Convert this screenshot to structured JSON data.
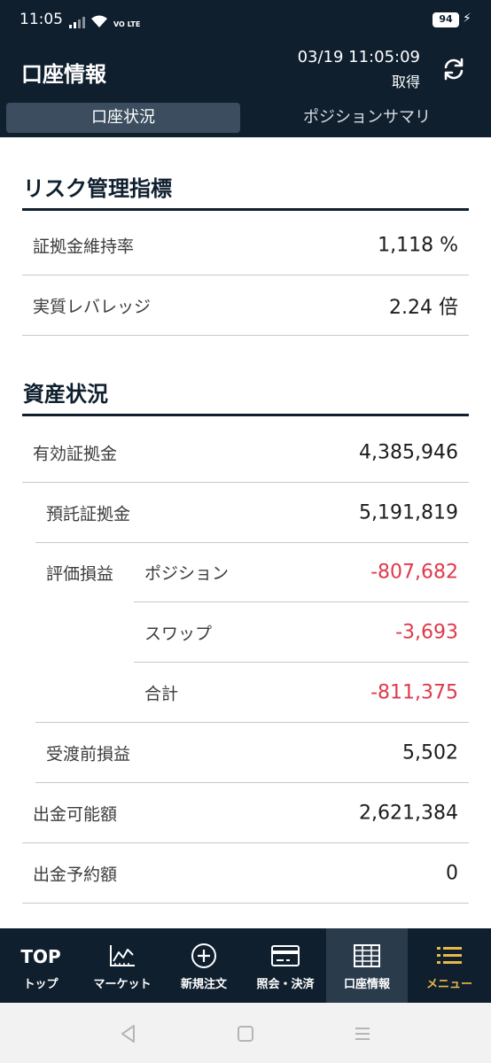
{
  "status_bar": {
    "time": "11:05",
    "network": "VO LTE",
    "battery": "94"
  },
  "header": {
    "title": "口座情報",
    "timestamp": "03/19 11:05:09",
    "fetch_label": "取得",
    "refresh_icon": "refresh-icon"
  },
  "tabs": [
    {
      "label": "口座状況",
      "active": true
    },
    {
      "label": "ポジションサマリ",
      "active": false
    }
  ],
  "risk": {
    "title": "リスク管理指標",
    "rows": [
      {
        "label": "証拠金維持率",
        "value": "1,118 %"
      },
      {
        "label": "実質レバレッジ",
        "value": "2.24 倍"
      }
    ]
  },
  "assets": {
    "title": "資産状況",
    "effective_margin": {
      "label": "有効証拠金",
      "value": "4,385,946"
    },
    "deposit_margin": {
      "label": "預託証拠金",
      "value": "5,191,819"
    },
    "valuation": {
      "label": "評価損益",
      "position": {
        "label": "ポジション",
        "value": "-807,682"
      },
      "swap": {
        "label": "スワップ",
        "value": "-3,693"
      },
      "total": {
        "label": "合計",
        "value": "-811,375"
      }
    },
    "pre_settlement": {
      "label": "受渡前損益",
      "value": "5,502"
    },
    "withdrawable": {
      "label": "出金可能額",
      "value": "2,621,384"
    },
    "withdraw_reserved": {
      "label": "出金予約額",
      "value": "0"
    }
  },
  "colors": {
    "navy": "#0f1f2e",
    "negative": "#e0394a",
    "menu_accent": "#e8b84a"
  },
  "bottom_nav": {
    "top": {
      "icon_text": "TOP",
      "label": "トップ"
    },
    "market": {
      "label": "マーケット",
      "icon": "chart-icon"
    },
    "new_order": {
      "label": "新規注文",
      "icon": "plus-circle-icon"
    },
    "inquiry": {
      "label": "照会・決済",
      "icon": "card-icon"
    },
    "account": {
      "label": "口座情報",
      "icon": "grid-table-icon"
    },
    "menu": {
      "label": "メニュー",
      "icon": "list-icon"
    }
  }
}
